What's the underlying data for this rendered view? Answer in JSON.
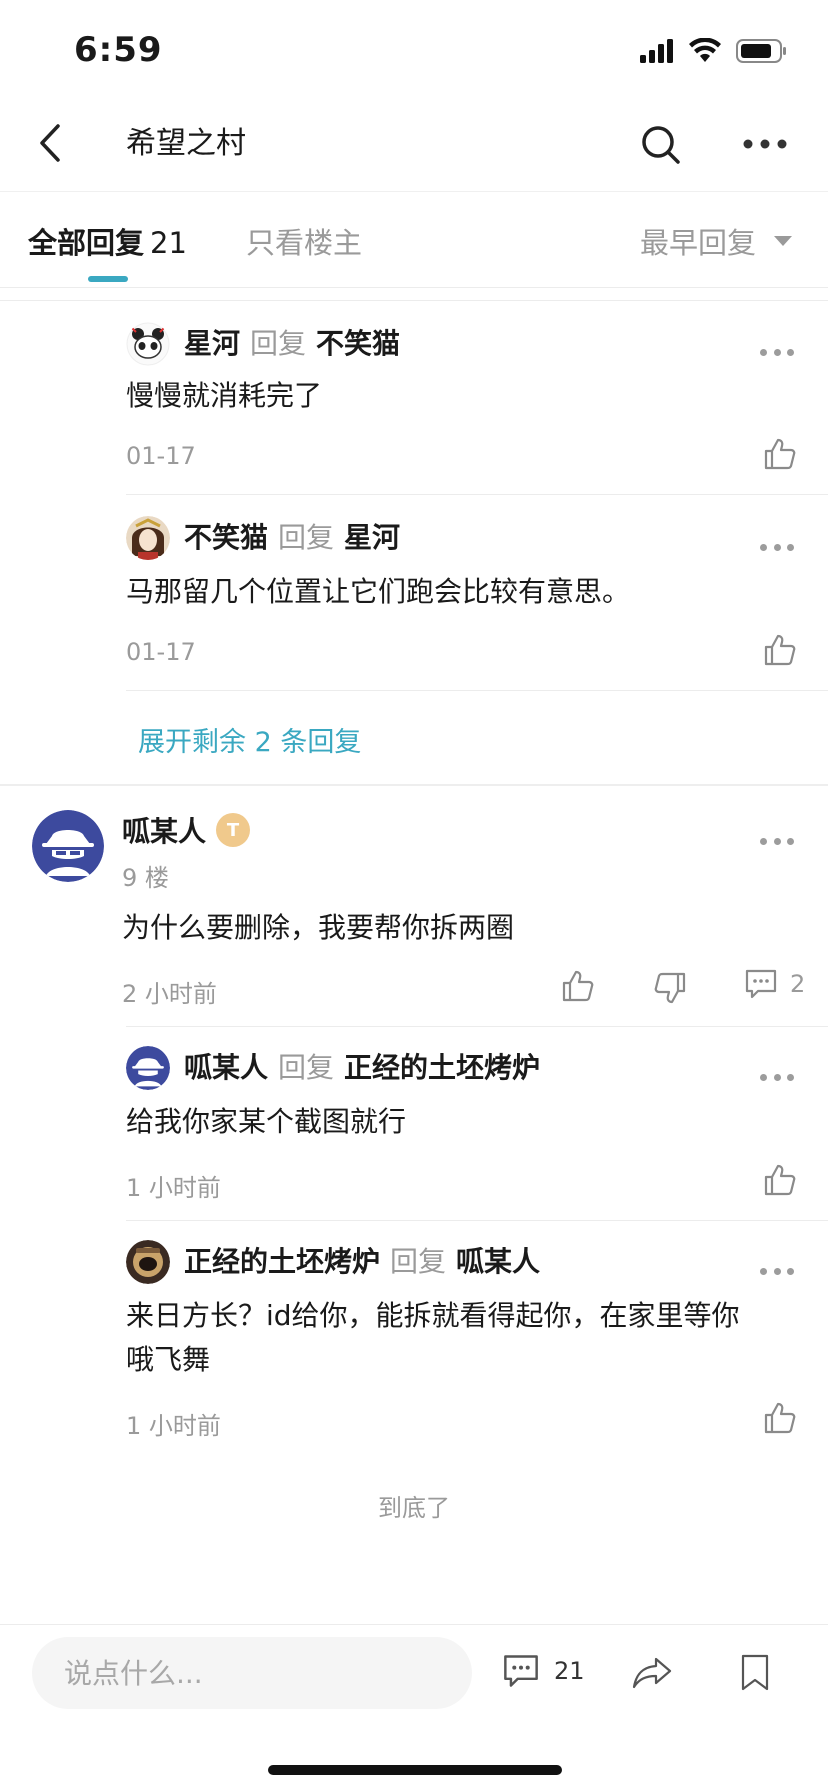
{
  "status_bar": {
    "time": "6:59"
  },
  "header": {
    "title": "希望之村"
  },
  "tabs": {
    "all_label": "全部回复",
    "all_count": "21",
    "owner_only": "只看楼主",
    "sort": "最早回复"
  },
  "thread1": {
    "replies": [
      {
        "author": "星河",
        "reply_word": "回复",
        "target": "不笑猫",
        "text": "慢慢就消耗完了",
        "time": "01-17"
      },
      {
        "author": "不笑猫",
        "reply_word": "回复",
        "target": "星河",
        "text": "马那留几个位置让它们跑会比较有意思。",
        "time": "01-17"
      }
    ],
    "expand": "展开剩余 2 条回复"
  },
  "post": {
    "author": "呱某人",
    "badge": "T",
    "floor": "9 楼",
    "text": "为什么要删除，我要帮你拆两圈",
    "time": "2 小时前",
    "comment_count": "2",
    "replies": [
      {
        "author": "呱某人",
        "reply_word": "回复",
        "target": "正经的土坯烤炉",
        "text": "给我你家某个截图就行",
        "time": "1 小时前"
      },
      {
        "author": "正经的土坯烤炉",
        "reply_word": "回复",
        "target": "呱某人",
        "text_line1": "来日方长？id给你，能拆就看得起你，在家里等你",
        "text_line2": "哦飞舞",
        "time": "1 小时前"
      }
    ]
  },
  "end_text": "到底了",
  "bottom_bar": {
    "input_placeholder": "说点什么...",
    "comment_count": "21"
  },
  "icons": [
    "back-icon",
    "search-icon",
    "more-icon",
    "like-icon",
    "dislike-icon",
    "comment-icon",
    "share-icon",
    "bookmark-icon"
  ],
  "colors": {
    "accent": "#3aa8c1",
    "muted": "#9a9a9a"
  }
}
